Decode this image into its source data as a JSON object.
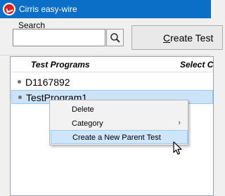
{
  "window": {
    "title": "Cirris easy-wire"
  },
  "search": {
    "label": "Search",
    "value": "",
    "placeholder": ""
  },
  "toolbar": {
    "create_test_label_prefix": "C",
    "create_test_label_rest": "reate Test"
  },
  "list": {
    "columns": [
      "Test Programs",
      "Select C"
    ],
    "items": [
      {
        "label": "D1167892"
      },
      {
        "label": "TestProgram1"
      }
    ]
  },
  "context_menu": {
    "items": [
      {
        "label": "Delete"
      },
      {
        "label": "Category",
        "arrow": "›"
      },
      {
        "label": "Create a New Parent Test"
      }
    ]
  },
  "colors": {
    "titlebar": "#0b6fc8",
    "selection": "#cce3f8",
    "menu_highlight": "#cfe5fb"
  }
}
